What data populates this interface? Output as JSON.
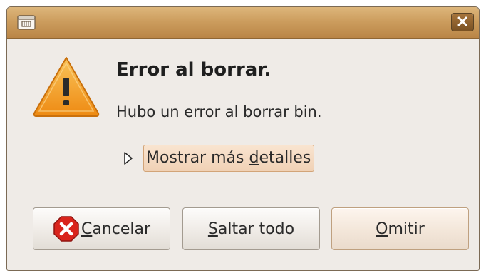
{
  "titlebar": {
    "app_icon": "file-manager-icon",
    "close_icon": "close-icon"
  },
  "dialog": {
    "icon": "warning-icon",
    "heading": "Error al borrar.",
    "message": "Hubo un error al borrar bin.",
    "details": {
      "arrow_icon": "expander-arrow-icon",
      "label_pre": "Mostrar más ",
      "label_mnemonic": "d",
      "label_post": "etalles"
    }
  },
  "buttons": {
    "cancel": {
      "icon": "cancel-icon",
      "mnemonic": "C",
      "rest": "ancelar"
    },
    "skip_all": {
      "mnemonic": "S",
      "rest": "altar todo"
    },
    "skip": {
      "mnemonic": "O",
      "rest": "mitir"
    }
  },
  "colors": {
    "titlebar": "#cc9d5e",
    "background": "#efebe7",
    "warning": "#f29b1b",
    "cancel_icon": "#d9241c"
  }
}
